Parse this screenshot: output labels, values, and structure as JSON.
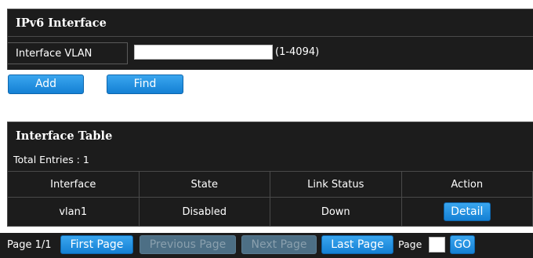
{
  "ipv6_section": {
    "title": "IPv6 Interface",
    "vlan_label": "Interface VLAN",
    "vlan_value": "",
    "vlan_hint": "(1-4094)",
    "add_label": "Add",
    "find_label": "Find"
  },
  "table_section": {
    "title": "Interface Table",
    "total_entries": "Total Entries : 1",
    "columns": [
      "Interface",
      "State",
      "Link Status",
      "Action"
    ],
    "rows": [
      {
        "interface": "vlan1",
        "state": "Disabled",
        "link_status": "Down",
        "action_label": "Detail"
      }
    ]
  },
  "pager": {
    "page_info": "Page 1/1",
    "first_label": "First Page",
    "previous_label": "Previous Page",
    "next_label": "Next Page",
    "last_label": "Last Page",
    "page_label": "Page",
    "page_value": "",
    "go_label": "GO"
  },
  "colors": {
    "panel": "#1c1c1c",
    "button": "#1c8ee3",
    "button_disabled": "#4d6f85"
  }
}
